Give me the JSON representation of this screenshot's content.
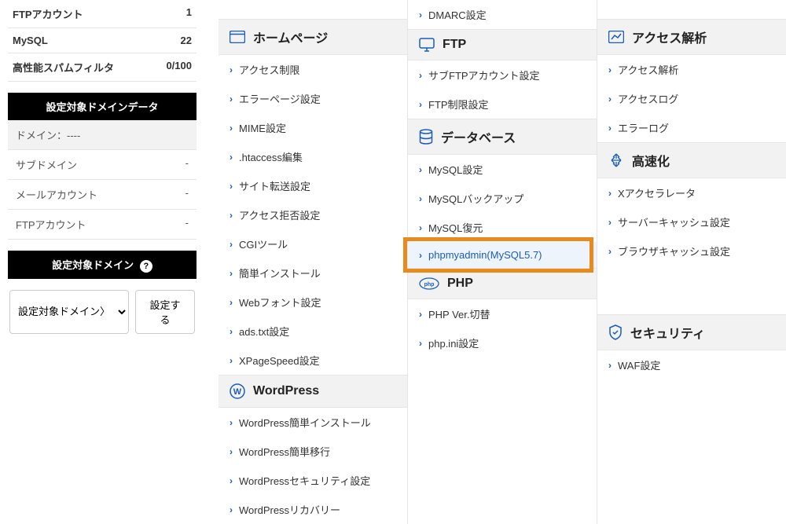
{
  "sidebar": {
    "stats": [
      {
        "label": "FTPアカウント",
        "value": "1"
      },
      {
        "label": "MySQL",
        "value": "22"
      },
      {
        "label": "高性能スパムフィルタ",
        "value": "0/100"
      }
    ],
    "domain_data_header": "設定対象ドメインデータ",
    "domain_rows": [
      {
        "label": "ドメイン：",
        "value": "----",
        "shaded": true
      },
      {
        "label": "サブドメイン",
        "value": "-"
      },
      {
        "label": "メールアカウント",
        "value": "-"
      },
      {
        "label": "FTPアカウント",
        "value": "-"
      }
    ],
    "domain_target_header": "設定対象ドメイン",
    "domain_select_placeholder": "設定対象ドメイン〉",
    "set_button": "設定する"
  },
  "col1": {
    "homepage": {
      "title": "ホームページ",
      "items": [
        "アクセス制限",
        "エラーページ設定",
        "MIME設定",
        ".htaccess編集",
        "サイト転送設定",
        "アクセス拒否設定",
        "CGIツール",
        "簡単インストール",
        "Webフォント設定",
        "ads.txt設定",
        "XPageSpeed設定"
      ]
    },
    "wordpress": {
      "title": "WordPress",
      "items": [
        "WordPress簡単インストール",
        "WordPress簡単移行",
        "WordPressセキュリティ設定",
        "WordPressリカバリー"
      ]
    }
  },
  "col2": {
    "top_item": "DMARC設定",
    "ftp": {
      "title": "FTP",
      "items": [
        "サブFTPアカウント設定",
        "FTP制限設定"
      ]
    },
    "database": {
      "title": "データベース",
      "items": [
        "MySQL設定",
        "MySQLバックアップ",
        "MySQL復元",
        "phpmyadmin(MySQL5.7)"
      ]
    },
    "php": {
      "title": "PHP",
      "items": [
        "PHP Ver.切替",
        "php.ini設定"
      ]
    }
  },
  "col3": {
    "analytics": {
      "title": "アクセス解析",
      "items": [
        "アクセス解析",
        "アクセスログ",
        "エラーログ"
      ]
    },
    "speed": {
      "title": "高速化",
      "items": [
        "Xアクセラレータ",
        "サーバーキャッシュ設定",
        "ブラウザキャッシュ設定"
      ]
    },
    "security": {
      "title": "セキュリティ",
      "items": [
        "WAF設定"
      ]
    }
  }
}
